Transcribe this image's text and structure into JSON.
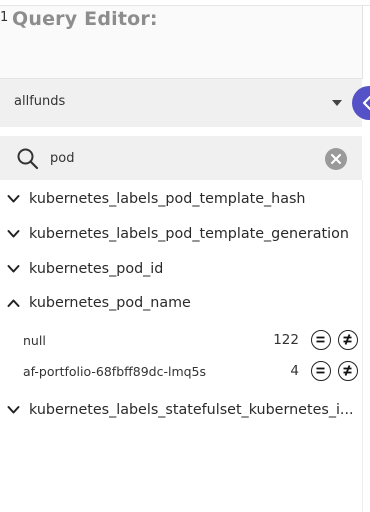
{
  "editor": {
    "line_number": "1",
    "title": "Query Editor:"
  },
  "index_select": {
    "value": "allfunds"
  },
  "search": {
    "value": "pod"
  },
  "fields": [
    {
      "name": "kubernetes_labels_pod_template_hash",
      "expanded": false
    },
    {
      "name": "kubernetes_labels_pod_template_generation",
      "expanded": false
    },
    {
      "name": "kubernetes_pod_id",
      "expanded": false
    },
    {
      "name": "kubernetes_pod_name",
      "expanded": true
    },
    {
      "name": "kubernetes_labels_statefulset_kubernetes_i...",
      "expanded": false
    }
  ],
  "pod_name_values": [
    {
      "value": "null",
      "count": "122"
    },
    {
      "value": "af-portfolio-68fbff89dc-lmq5s",
      "count": "4"
    }
  ],
  "colors": {
    "accent": "#5552c7",
    "panel_bg": "#f0f0f0"
  }
}
